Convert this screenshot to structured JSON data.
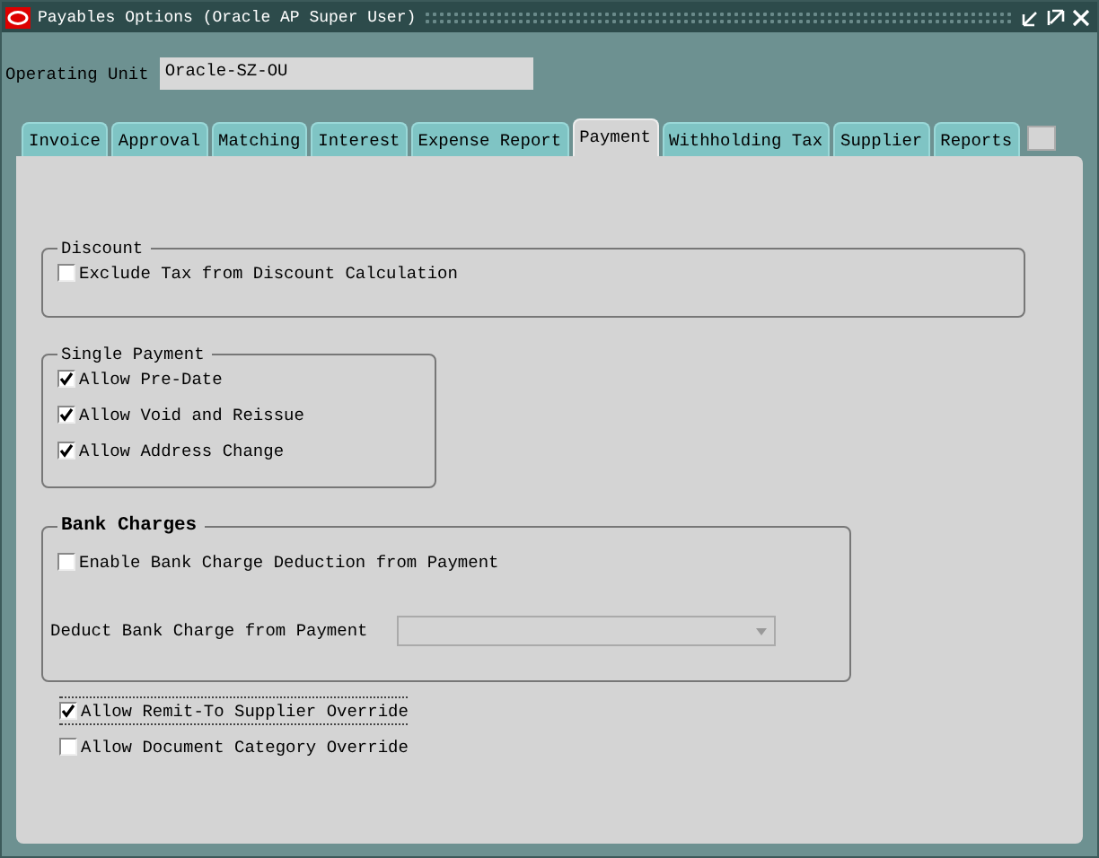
{
  "window": {
    "title": "Payables Options (Oracle AP Super User)"
  },
  "operating_unit": {
    "label": "Operating Unit",
    "value": "Oracle-SZ-OU"
  },
  "tabs": [
    {
      "label": "Invoice",
      "selected": false
    },
    {
      "label": "Approval",
      "selected": false
    },
    {
      "label": "Matching",
      "selected": false
    },
    {
      "label": "Interest",
      "selected": false
    },
    {
      "label": "Expense Report",
      "selected": false
    },
    {
      "label": "Payment",
      "selected": true
    },
    {
      "label": "Withholding Tax",
      "selected": false
    },
    {
      "label": "Supplier",
      "selected": false
    },
    {
      "label": "Reports",
      "selected": false
    }
  ],
  "discount": {
    "title": "Discount",
    "options": [
      {
        "label": "Exclude Tax from Discount Calculation",
        "checked": false
      }
    ]
  },
  "single_payment": {
    "title": "Single Payment",
    "options": [
      {
        "label": "Allow Pre-Date",
        "checked": true
      },
      {
        "label": "Allow Void and Reissue",
        "checked": true
      },
      {
        "label": "Allow Address Change",
        "checked": true
      }
    ]
  },
  "bank_charges": {
    "title": "Bank Charges",
    "options": [
      {
        "label": "Enable Bank Charge Deduction from Payment",
        "checked": false
      }
    ],
    "deduct_label": "Deduct Bank Charge from Payment"
  },
  "options": [
    {
      "label": "Allow Remit-To Supplier Override",
      "checked": true,
      "focused": true
    },
    {
      "label": "Allow Document Category Override",
      "checked": false,
      "focused": false
    }
  ]
}
